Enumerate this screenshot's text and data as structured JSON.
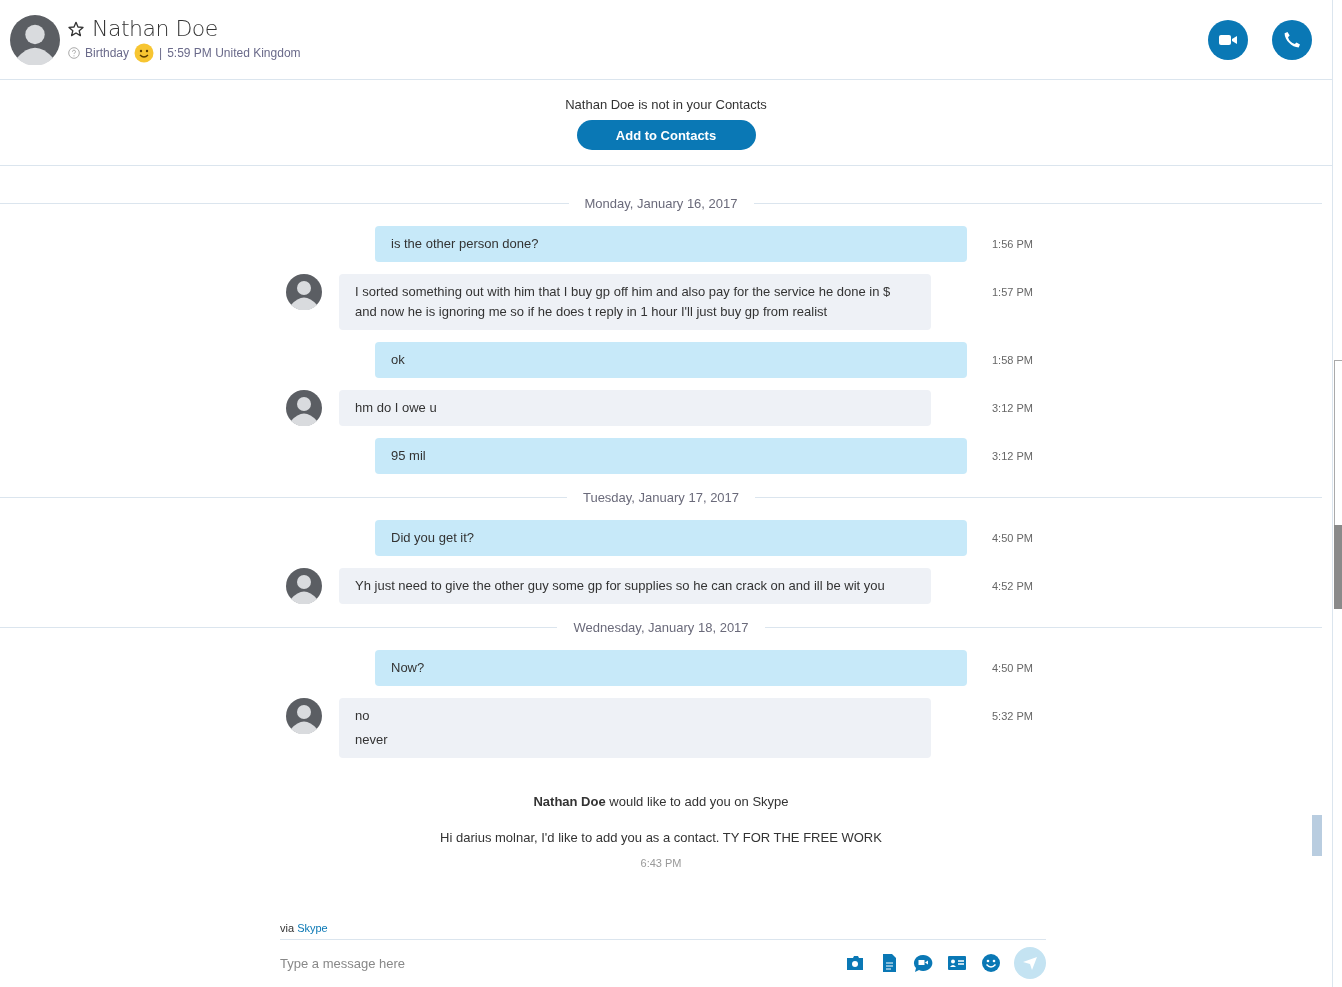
{
  "header": {
    "name": "Nathan Doe",
    "favorite": false,
    "status_text": "Birthday",
    "divider": "|",
    "local_time": "5:59 PM United Kingdom"
  },
  "notice": {
    "text": "Nathan Doe is not in your Contacts",
    "button": "Add to Contacts"
  },
  "conversation": [
    {
      "kind": "date",
      "text": "Monday, January 16, 2017"
    },
    {
      "kind": "outgoing",
      "lines": [
        "is the other person done?"
      ],
      "time": "1:56 PM"
    },
    {
      "kind": "incoming",
      "lines": [
        "I sorted something out with him that I buy gp off him and also pay for the service he done in $ and now he is ignoring me so if he does t reply in 1 hour I'll just buy gp from realist"
      ],
      "time": "1:57 PM"
    },
    {
      "kind": "outgoing",
      "lines": [
        "ok"
      ],
      "time": "1:58 PM"
    },
    {
      "kind": "incoming",
      "lines": [
        "hm do I owe u"
      ],
      "time": "3:12 PM"
    },
    {
      "kind": "outgoing",
      "lines": [
        "95 mil"
      ],
      "time": "3:12 PM"
    },
    {
      "kind": "date",
      "text": "Tuesday, January 17, 2017"
    },
    {
      "kind": "outgoing",
      "lines": [
        "Did you get it?"
      ],
      "time": "4:50 PM"
    },
    {
      "kind": "incoming",
      "lines": [
        "Yh just need to give the other guy some gp for supplies so he can crack on and ill be wit you"
      ],
      "time": "4:52 PM"
    },
    {
      "kind": "date",
      "text": "Wednesday, January 18, 2017"
    },
    {
      "kind": "outgoing",
      "lines": [
        "Now?"
      ],
      "time": "4:50 PM"
    },
    {
      "kind": "incoming",
      "lines": [
        "no",
        "never"
      ],
      "time": "5:32 PM"
    }
  ],
  "request": {
    "title": "**Nathan Doe** would like to add you on Skype",
    "message": "Hi darius molnar, I'd like to add you as a contact. TY FOR THE FREE WORK",
    "time": "6:43 PM"
  },
  "composer": {
    "via": "via",
    "via_link": "Skype",
    "placeholder": "Type a message here"
  }
}
